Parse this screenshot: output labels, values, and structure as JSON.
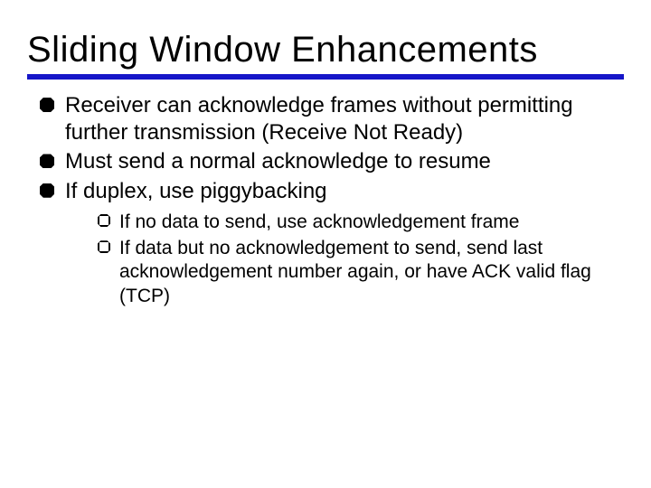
{
  "title": "Sliding Window Enhancements",
  "bullets": [
    {
      "text": "Receiver can acknowledge frames without permitting further transmission (Receive Not Ready)"
    },
    {
      "text": "Must send a normal acknowledge to resume"
    },
    {
      "text": "If duplex, use piggybacking",
      "children": [
        {
          "text": "If no data to send, use acknowledgement frame"
        },
        {
          "text": "If data but no acknowledgement to send, send last acknowledgement number again, or have ACK valid flag (TCP)"
        }
      ]
    }
  ]
}
